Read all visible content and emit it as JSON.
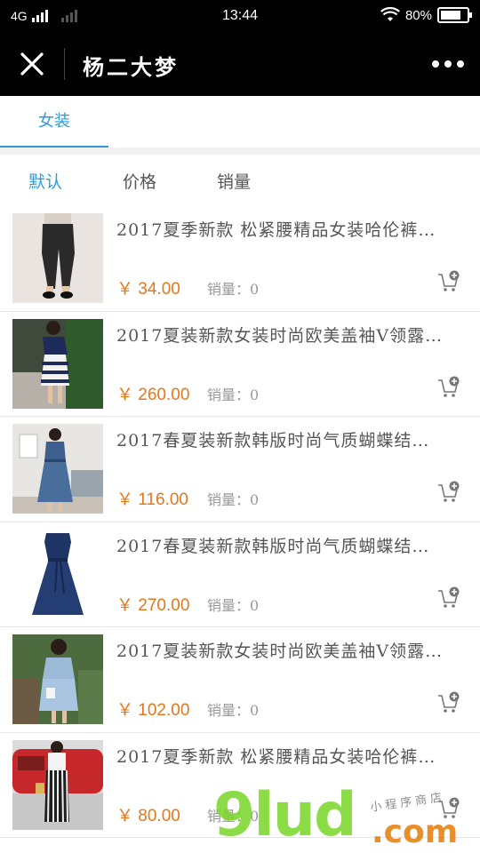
{
  "status_bar": {
    "network": "4G",
    "time": "13:44",
    "battery": "80%"
  },
  "nav": {
    "title": "杨二大梦",
    "close_icon": "close-icon",
    "more_icon": "more-dots-icon"
  },
  "category_tabs": [
    {
      "label": "女装",
      "active": true
    }
  ],
  "sort_options": [
    {
      "label": "默认",
      "active": true
    },
    {
      "label": "价格",
      "active": false
    },
    {
      "label": "销量",
      "active": false
    }
  ],
  "products": [
    {
      "title": "2017夏季新款 松紧腰精品女装哈伦裤…",
      "price": "￥ 34.00",
      "sales": "销量：0"
    },
    {
      "title": "2017夏装新款女装时尚欧美盖袖V领露…",
      "price": "￥ 260.00",
      "sales": "销量：0"
    },
    {
      "title": "2017春夏装新款韩版时尚气质蝴蝶结…",
      "price": "￥ 116.00",
      "sales": "销量：0"
    },
    {
      "title": "2017春夏装新款韩版时尚气质蝴蝶结…",
      "price": "￥ 270.00",
      "sales": "销量：0"
    },
    {
      "title": "2017夏装新款女装时尚欧美盖袖V领露…",
      "price": "￥ 102.00",
      "sales": "销量：0"
    },
    {
      "title": "2017夏季新款 松紧腰精品女装哈伦裤…",
      "price": "￥ 80.00",
      "sales": "销量：0"
    }
  ],
  "watermark": {
    "logo": "9lud",
    "domain": ".com",
    "tagline": "小程序商店"
  },
  "colors": {
    "accent": "#2f9bd6",
    "price": "#e3771a",
    "header": "#000000"
  }
}
